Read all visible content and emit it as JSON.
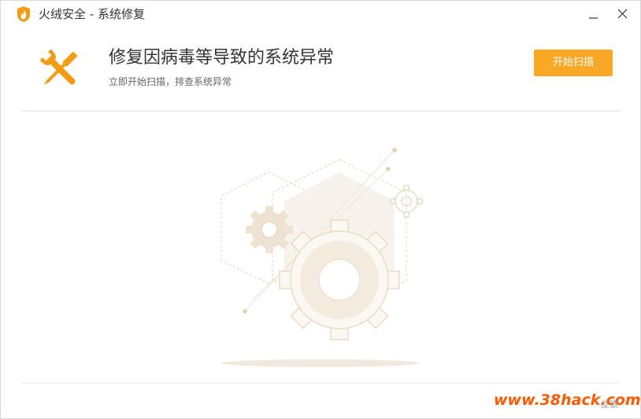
{
  "window": {
    "title": "火绒安全 - 系统修复",
    "minimize_icon": "minimize-icon",
    "close_icon": "close-icon"
  },
  "header": {
    "headline": "修复因病毒等导致的系统异常",
    "subline": "立即开始扫描，排查系统异常",
    "start_button": "开始扫描",
    "icon": "wrench-screwdriver-icon"
  },
  "illustration": {
    "icon": "gears-illustration"
  },
  "footer": {
    "watermark": "www.38hack.com",
    "link_label": "反馈"
  },
  "colors": {
    "accent": "#f9a825",
    "watermark": "#ff5a00"
  }
}
